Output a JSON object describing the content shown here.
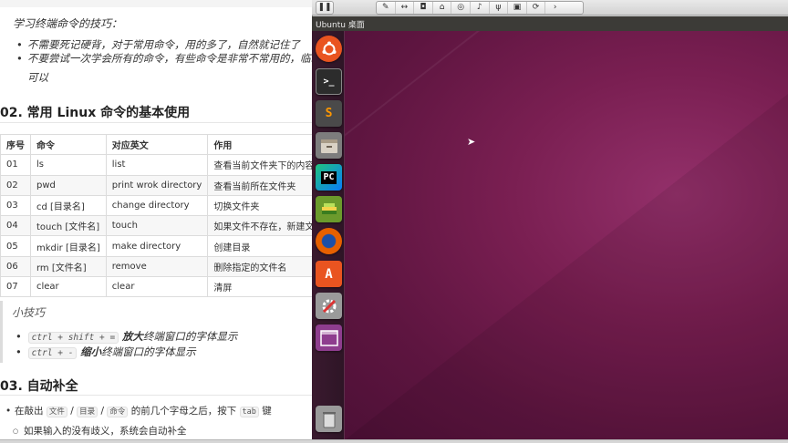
{
  "doc": {
    "tips_title": "学习终端命令的技巧：",
    "tips": [
      "不需要死记硬背，对于常用命令，用的多了，自然就记住了",
      "不要尝试一次学会所有的命令，有些命令是非常不常用的，临时",
      "可以"
    ],
    "section2_title": "02. 常用 Linux 命令的基本使用",
    "table": {
      "headers": [
        "序号",
        "命令",
        "对应英文",
        "作用"
      ],
      "rows": [
        [
          "01",
          "ls",
          "list",
          "查看当前文件夹下的内容"
        ],
        [
          "02",
          "pwd",
          "print wrok directory",
          "查看当前所在文件夹"
        ],
        [
          "03",
          "cd [目录名]",
          "change directory",
          "切换文件夹"
        ],
        [
          "04",
          "touch [文件名]",
          "touch",
          "如果文件不存在，新建文件"
        ],
        [
          "05",
          "mkdir [目录名]",
          "make directory",
          "创建目录"
        ],
        [
          "06",
          "rm [文件名]",
          "remove",
          "删除指定的文件名"
        ],
        [
          "07",
          "clear",
          "clear",
          "清屏"
        ]
      ]
    },
    "small_tips_title": "小技巧",
    "shortcut1": {
      "key": "ctrl + shift + =",
      "bold": "放大",
      "rest": "终端窗口的字体显示"
    },
    "shortcut2": {
      "key": "ctrl + -",
      "bold": "缩小",
      "rest": "终端窗口的字体显示"
    },
    "section3_title": "03. 自动补全",
    "autocomplete": {
      "prefix": "在敲出",
      "k1": "文件",
      "sep1": "/",
      "k2": "目录",
      "sep2": "/",
      "k3": "命令",
      "mid": "的前几个字母之后，按下",
      "k4": "tab",
      "suffix": "键"
    },
    "autocomplete_sub": "如果输入的没有歧义，系统会自动补全"
  },
  "vm": {
    "toolbar_icons": [
      "pause-icon",
      "wrench-icon",
      "arrows-icon",
      "disk-icon",
      "usb-disk-icon",
      "cd-icon",
      "speaker-icon",
      "usb-icon",
      "save-icon",
      "refresh-icon",
      "chevron-right-icon"
    ],
    "ubuntu_title": "Ubuntu 桌面",
    "launcher": [
      {
        "name": "ubuntu-dash-icon",
        "color": "#e95420"
      },
      {
        "name": "terminal-icon",
        "color": "#2c2c2c"
      },
      {
        "name": "sublime-text-icon",
        "color": "#4a4a4a"
      },
      {
        "name": "file-manager-icon",
        "color": "#7d7d7d"
      },
      {
        "name": "pycharm-icon",
        "color": "#21c37d"
      },
      {
        "name": "books-icon",
        "color": "#6b9a2c"
      },
      {
        "name": "firefox-icon",
        "color": "#e66000"
      },
      {
        "name": "software-center-icon",
        "color": "#e95420"
      },
      {
        "name": "settings-icon",
        "color": "#9a9a9a"
      },
      {
        "name": "workspace-icon",
        "color": "#8e3d8e"
      },
      {
        "name": "trash-icon",
        "color": "#9a9a9a"
      }
    ]
  }
}
